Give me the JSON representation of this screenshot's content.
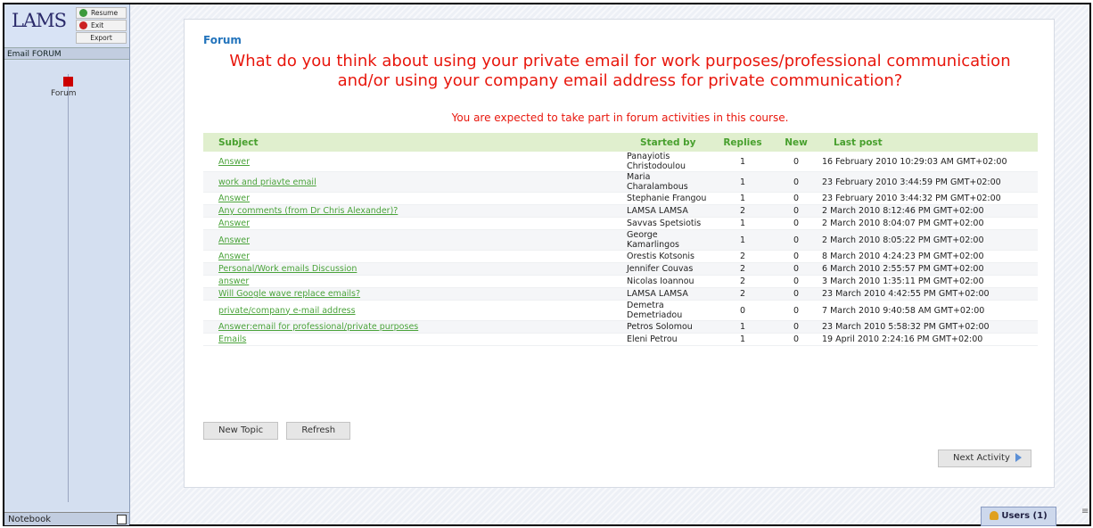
{
  "app": {
    "logo": "LAMS"
  },
  "controls": {
    "resume": "Resume",
    "exit": "Exit",
    "export": "Export"
  },
  "sequence": {
    "title": "Email FORUM",
    "activity": "Forum"
  },
  "notebook": {
    "label": "Notebook"
  },
  "forum": {
    "title": "Forum",
    "question": "What do you think about using your private email for work purposes/professional communication and/or using your company email address for private communication?",
    "expected": "You are expected to take part in forum activities in this course.",
    "columns": {
      "subject": "Subject",
      "started_by": "Started by",
      "replies": "Replies",
      "new": "New",
      "last_post": "Last post"
    },
    "topics": [
      {
        "subject": "Answer",
        "started_by": "Panayiotis Christodoulou",
        "replies": "1",
        "new": "0",
        "last_post": "16 February 2010 10:29:03 AM GMT+02:00"
      },
      {
        "subject": "work and priavte email",
        "started_by": "Maria Charalambous",
        "replies": "1",
        "new": "0",
        "last_post": "23 February 2010 3:44:59 PM GMT+02:00"
      },
      {
        "subject": "Answer",
        "started_by": "Stephanie Frangou",
        "replies": "1",
        "new": "0",
        "last_post": "23 February 2010 3:44:32 PM GMT+02:00"
      },
      {
        "subject": "Any comments (from Dr Chris Alexander)?",
        "started_by": "LAMSA LAMSA",
        "replies": "2",
        "new": "0",
        "last_post": "2 March 2010 8:12:46 PM GMT+02:00"
      },
      {
        "subject": "Answer",
        "started_by": "Savvas Spetsiotis",
        "replies": "1",
        "new": "0",
        "last_post": "2 March 2010 8:04:07 PM GMT+02:00"
      },
      {
        "subject": "Answer",
        "started_by": "George Kamarlingos",
        "replies": "1",
        "new": "0",
        "last_post": "2 March 2010 8:05:22 PM GMT+02:00"
      },
      {
        "subject": "Answer",
        "started_by": "Orestis Kotsonis",
        "replies": "2",
        "new": "0",
        "last_post": "8 March 2010 4:24:23 PM GMT+02:00"
      },
      {
        "subject": "Personal/Work emails Discussion",
        "started_by": "Jennifer Couvas",
        "replies": "2",
        "new": "0",
        "last_post": "6 March 2010 2:55:57 PM GMT+02:00"
      },
      {
        "subject": "answer",
        "started_by": "Nicolas Ioannou",
        "replies": "2",
        "new": "0",
        "last_post": "3 March 2010 1:35:11 PM GMT+02:00"
      },
      {
        "subject": "Will Google wave replace emails?",
        "started_by": "LAMSA LAMSA",
        "replies": "2",
        "new": "0",
        "last_post": "23 March 2010 4:42:55 PM GMT+02:00"
      },
      {
        "subject": "private/company e-mail address",
        "started_by": "Demetra Demetriadou",
        "replies": "0",
        "new": "0",
        "last_post": "7 March 2010 9:40:58 AM GMT+02:00"
      },
      {
        "subject": "Answer:email for professional/private purposes",
        "started_by": "Petros Solomou",
        "replies": "1",
        "new": "0",
        "last_post": "23 March 2010 5:58:32 PM GMT+02:00"
      },
      {
        "subject": "Emails",
        "started_by": "Eleni Petrou",
        "replies": "1",
        "new": "0",
        "last_post": "19 April 2010 2:24:16 PM GMT+02:00"
      }
    ],
    "buttons": {
      "new_topic": "New Topic",
      "refresh": "Refresh",
      "next_activity": "Next Activity"
    }
  },
  "users": {
    "label": "Users (1)",
    "close": "≡"
  }
}
